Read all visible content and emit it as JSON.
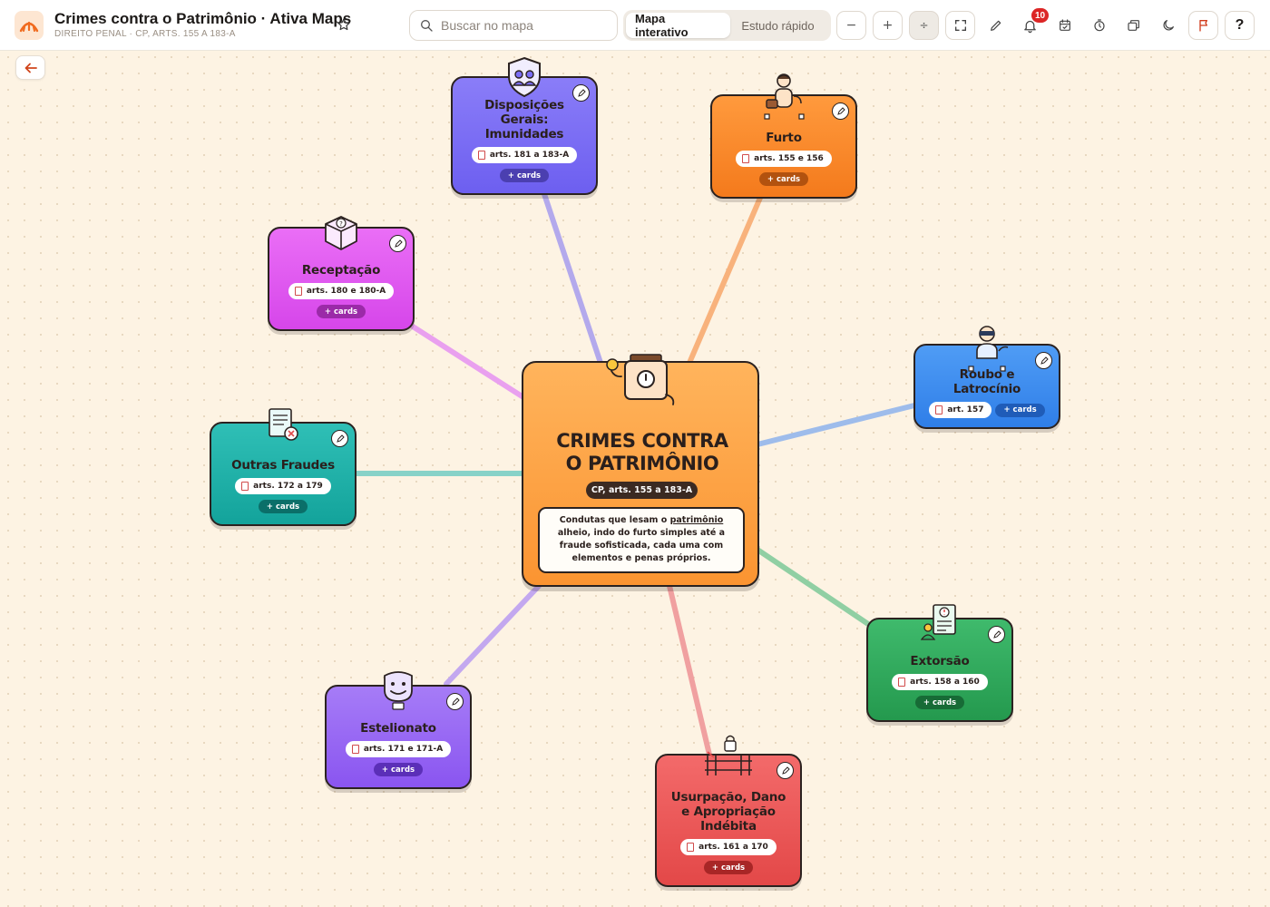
{
  "app": {
    "title": "Crimes contra o Patrimônio · Ativa Maps",
    "subtitle": "DIREITO PENAL · CP, ARTS. 155 A 183-A"
  },
  "search": {
    "placeholder": "Buscar no mapa",
    "value": ""
  },
  "modes": [
    {
      "label": "Mapa interativo",
      "active": true
    },
    {
      "label": "Estudo rápido",
      "active": false
    }
  ],
  "toolbar": {
    "zoom_out": "−",
    "zoom_in": "+",
    "fit": "÷",
    "notifications_count": "10",
    "help": "?"
  },
  "center": {
    "title_line1": "CRIMES CONTRA",
    "title_line2": "O PATRIMÔNIO",
    "reference": "CP, arts. 155 a 183-A",
    "desc_1": "Condutas que lesam o ",
    "desc_2": "patrimônio",
    "desc_3": " alheio, indo do furto simples até a fraude sofisticada, cada uma com ",
    "desc_4": "elementos",
    "desc_5": " e ",
    "desc_6": "penas próprios",
    "desc_7": "."
  },
  "nodes": {
    "disposicoes": {
      "title": "Disposições Gerais: Imunidades",
      "arts": "arts. 181 a 183-A",
      "cards": "+ cards",
      "color": "#7b6ef6"
    },
    "furto": {
      "title": "Furto",
      "arts": "arts. 155 e 156",
      "cards": "+ cards",
      "color": "#fb8a2a"
    },
    "receptacao": {
      "title": "Receptação",
      "arts": "arts. 180 e 180-A",
      "cards": "+ cards",
      "color": "#e15ef0"
    },
    "roubo": {
      "title": "Roubo e Latrocínio",
      "arts": "art. 157",
      "cards": "+ cards",
      "color": "#3f8ef0"
    },
    "outras": {
      "title": "Outras Fraudes",
      "arts": "arts. 172 a 179",
      "cards": "+ cards",
      "color": "#1fb3aa"
    },
    "extorsao": {
      "title": "Extorsão",
      "arts": "arts. 158 a 160",
      "cards": "+ cards",
      "color": "#2ea95f"
    },
    "estelionato": {
      "title": "Estelionato",
      "arts": "arts. 171 e 171-A",
      "cards": "+ cards",
      "color": "#9a6af5"
    },
    "usurpacao": {
      "title": "Usurpação, Dano e Apropriação Indébita",
      "arts": "arts. 161 a 170",
      "cards": "+ cards",
      "color": "#ef5a5a"
    }
  }
}
